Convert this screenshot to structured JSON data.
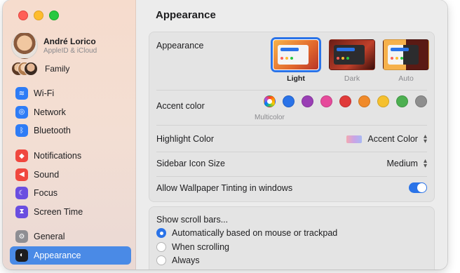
{
  "sidebar": {
    "profile": {
      "name": "André Lorico",
      "subtitle": "AppleID & iCloud"
    },
    "family": "Family",
    "group1": [
      {
        "label": "Wi-Fi",
        "icon": "wifi-icon",
        "color": "#2e7cf6",
        "glyph": "≋"
      },
      {
        "label": "Network",
        "icon": "globe-icon",
        "color": "#2e7cf6",
        "glyph": "◎"
      },
      {
        "label": "Bluetooth",
        "icon": "bluetooth-icon",
        "color": "#2e7cf6",
        "glyph": "ᛒ"
      }
    ],
    "group2": [
      {
        "label": "Notifications",
        "icon": "bell-icon",
        "color": "#f0473e",
        "glyph": "◆"
      },
      {
        "label": "Sound",
        "icon": "speaker-icon",
        "color": "#f0473e",
        "glyph": "◀"
      },
      {
        "label": "Focus",
        "icon": "moon-icon",
        "color": "#6a4ee0",
        "glyph": "☾"
      },
      {
        "label": "Screen Time",
        "icon": "hourglass-icon",
        "color": "#6a4ee0",
        "glyph": "⧗"
      }
    ],
    "group3": [
      {
        "label": "General",
        "icon": "gear-icon",
        "color": "#8e8e93",
        "glyph": "⚙",
        "active": false
      },
      {
        "label": "Appearance",
        "icon": "appearance-icon",
        "color": "#1d1d1f",
        "glyph": "◐",
        "active": true
      }
    ]
  },
  "main": {
    "title": "Appearance",
    "appearance": {
      "label": "Appearance",
      "options": [
        {
          "label": "Light",
          "selected": true
        },
        {
          "label": "Dark",
          "selected": false
        },
        {
          "label": "Auto",
          "selected": false
        }
      ]
    },
    "accent": {
      "label": "Accent color",
      "multicolor_label": "Multicolor",
      "colors": [
        "multi",
        "#2a73e8",
        "#9a3fb5",
        "#e64a9b",
        "#e03a3a",
        "#f08a2a",
        "#f5c02e",
        "#4caf50",
        "#8e8e8e"
      ]
    },
    "highlight": {
      "label": "Highlight Color",
      "value": "Accent Color"
    },
    "sidebar_icon": {
      "label": "Sidebar Icon Size",
      "value": "Medium"
    },
    "tinting": {
      "label": "Allow Wallpaper Tinting in windows",
      "on": true
    },
    "scroll": {
      "label": "Show scroll bars...",
      "options": [
        {
          "label": "Automatically based on mouse or trackpad",
          "selected": true
        },
        {
          "label": "When scrolling",
          "selected": false
        },
        {
          "label": "Always",
          "selected": false
        }
      ]
    }
  }
}
